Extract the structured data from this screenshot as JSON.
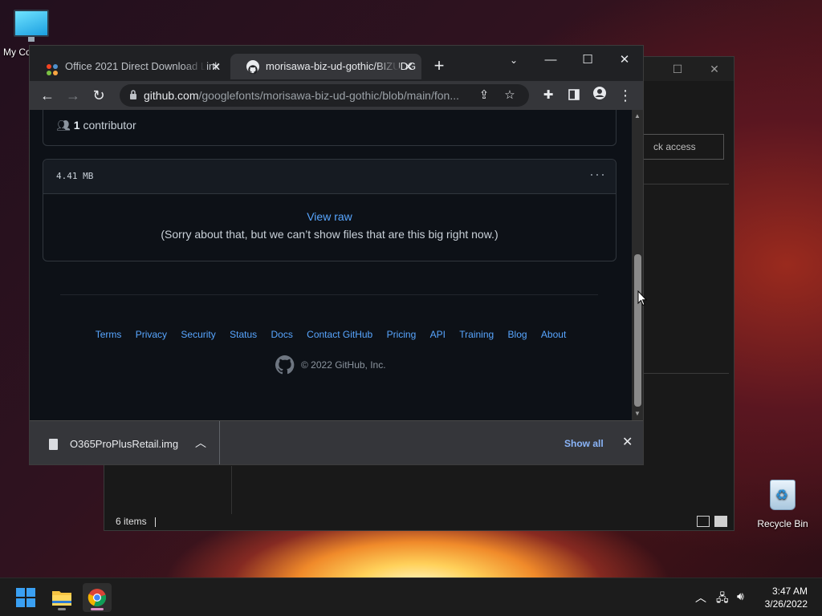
{
  "desktop": {
    "icons": [
      {
        "label": "My Co"
      },
      {
        "label": "Recycle Bin"
      }
    ]
  },
  "explorer": {
    "quick_access_label": "ck access",
    "status_items": "6 items"
  },
  "chrome": {
    "tabs": [
      {
        "title": "Office 2021 Direct Download Link",
        "active": false
      },
      {
        "title": "morisawa-biz-ud-gothic/BIZUDG",
        "active": true
      }
    ],
    "new_tab_symbol": "+",
    "url_host": "github.com",
    "url_path": "/googlefonts/morisawa-biz-ud-gothic/blob/main/fon..."
  },
  "page": {
    "contributors_count": "1",
    "contributors_label": " contributor",
    "file_size": "4.41 MB",
    "more_symbol": "···",
    "view_raw": "View raw",
    "too_big_message": "(Sorry about that, but we can’t show files that are this big right now.)",
    "footer_links": [
      "Terms",
      "Privacy",
      "Security",
      "Status",
      "Docs",
      "Contact GitHub",
      "Pricing",
      "API",
      "Training",
      "Blog",
      "About"
    ],
    "copyright": "© 2022 GitHub, Inc."
  },
  "downloads": {
    "file_name": "O365ProPlusRetail.img",
    "show_all": "Show all"
  },
  "taskbar": {
    "time": "3:47 AM",
    "date": "3/26/2022"
  },
  "colors": {
    "github_link": "#58a6ff",
    "github_bg": "#0d1117",
    "chrome_toolbar": "#35363a",
    "show_all": "#8ab4f8"
  }
}
